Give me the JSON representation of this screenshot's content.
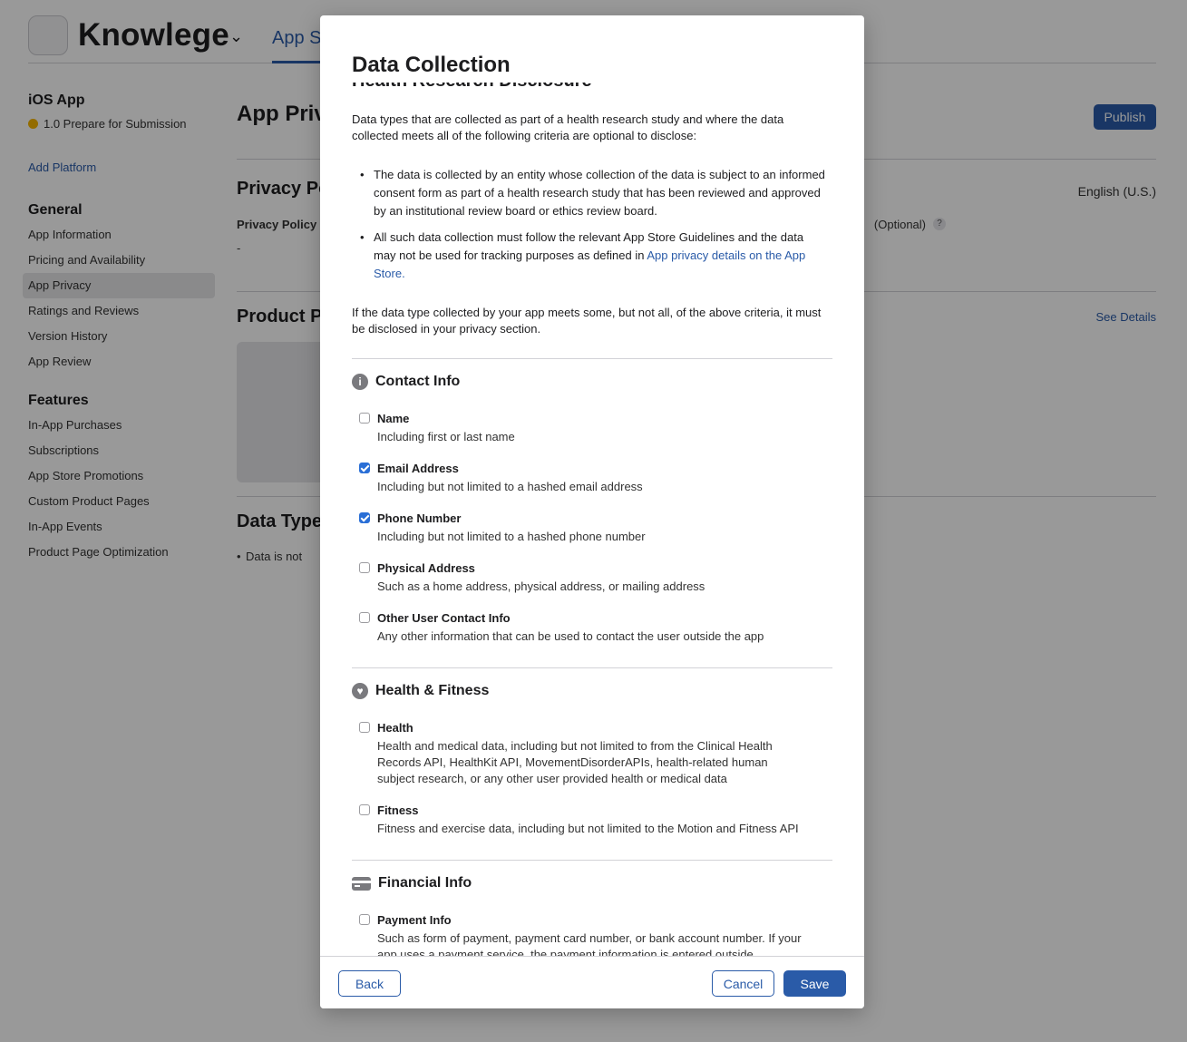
{
  "header": {
    "app_name": "Knowlege",
    "tab_label": "App St"
  },
  "sidebar": {
    "title": "iOS App",
    "status": "1.0 Prepare for Submission",
    "add_platform": "Add Platform",
    "general_heading": "General",
    "general_items": [
      {
        "label": "App Information"
      },
      {
        "label": "Pricing and Availability"
      },
      {
        "label": "App Privacy",
        "active": true
      },
      {
        "label": "Ratings and Reviews"
      },
      {
        "label": "Version History"
      },
      {
        "label": "App Review"
      }
    ],
    "features_heading": "Features",
    "feature_items": [
      {
        "label": "In-App Purchases"
      },
      {
        "label": "Subscriptions"
      },
      {
        "label": "App Store Promotions"
      },
      {
        "label": "Custom Product Pages"
      },
      {
        "label": "In-App Events"
      },
      {
        "label": "Product Page Optimization"
      }
    ]
  },
  "main": {
    "title": "App Priv",
    "publish_label": "Publish",
    "privacy_heading": "Privacy Po",
    "language": "English (U.S.)",
    "privacy_url_label": "Privacy Policy U",
    "privacy_url_value": "-",
    "optional_label": "(Optional)",
    "help_label": "?",
    "product_heading": "Product P",
    "see_details": "See Details",
    "data_types_heading": "Data Type",
    "data_bullet": "Data is not"
  },
  "modal": {
    "title": "Data Collection",
    "clipped_heading": "Health Research Disclosure",
    "intro": "Data types that are collected as part of a health research study and where the data collected meets all of the following criteria are optional to disclose:",
    "criteria_1": "The data is collected by an entity whose collection of the data is subject to an informed consent form as part of a health research study that has been reviewed and approved by an institutional review board or ethics review board.",
    "criteria_2_text": "All such data collection must follow the relevant App Store Guidelines and the data may not be used for tracking purposes as defined in ",
    "criteria_2_link": "App privacy details on the App Store.",
    "partial_note": "If the data type collected by your app meets some, but not all, of the above criteria, it must be disclosed in your privacy section.",
    "sections": {
      "contact": {
        "title": "Contact Info",
        "icon": "info-icon",
        "items": [
          {
            "title": "Name",
            "desc": "Including first or last name",
            "checked": false
          },
          {
            "title": "Email Address",
            "desc": "Including but not limited to a hashed email address",
            "checked": true
          },
          {
            "title": "Phone Number",
            "desc": "Including but not limited to a hashed phone number",
            "checked": true
          },
          {
            "title": "Physical Address",
            "desc": "Such as a home address, physical address, or mailing address",
            "checked": false
          },
          {
            "title": "Other User Contact Info",
            "desc": "Any other information that can be used to contact the user outside the app",
            "checked": false
          }
        ]
      },
      "health": {
        "title": "Health & Fitness",
        "icon": "heart-icon",
        "items": [
          {
            "title": "Health",
            "desc": "Health and medical data, including but not limited to from the Clinical Health Records API, HealthKit API, MovementDisorderAPIs, health-related human subject research, or any other user provided health or medical data",
            "checked": false
          },
          {
            "title": "Fitness",
            "desc": "Fitness and exercise data, including but not limited to the Motion and Fitness API",
            "checked": false
          }
        ]
      },
      "financial": {
        "title": "Financial Info",
        "icon": "credit-card-icon",
        "items": [
          {
            "title": "Payment Info",
            "desc": "Such as form of payment, payment card number, or bank account number. If your app uses a payment service, the payment information is entered outside",
            "checked": false
          }
        ]
      }
    },
    "footer": {
      "back": "Back",
      "cancel": "Cancel",
      "save": "Save"
    }
  }
}
